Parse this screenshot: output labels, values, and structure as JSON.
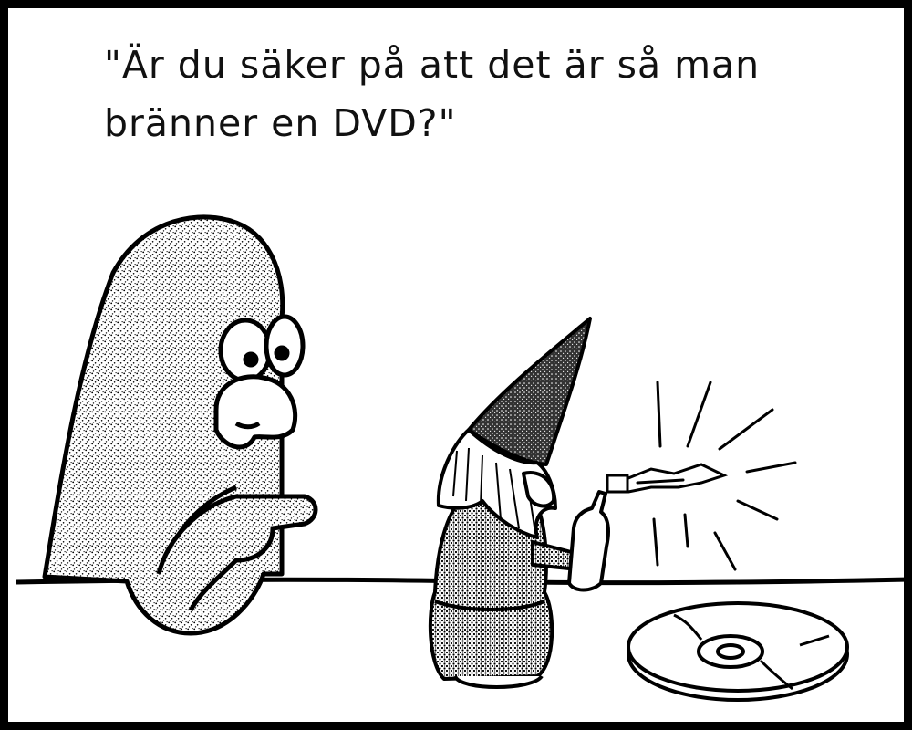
{
  "caption": "\"Är du säker på att det är så man bränner en DVD?\"",
  "colors": {
    "ink": "#000000",
    "paper": "#ffffff"
  }
}
